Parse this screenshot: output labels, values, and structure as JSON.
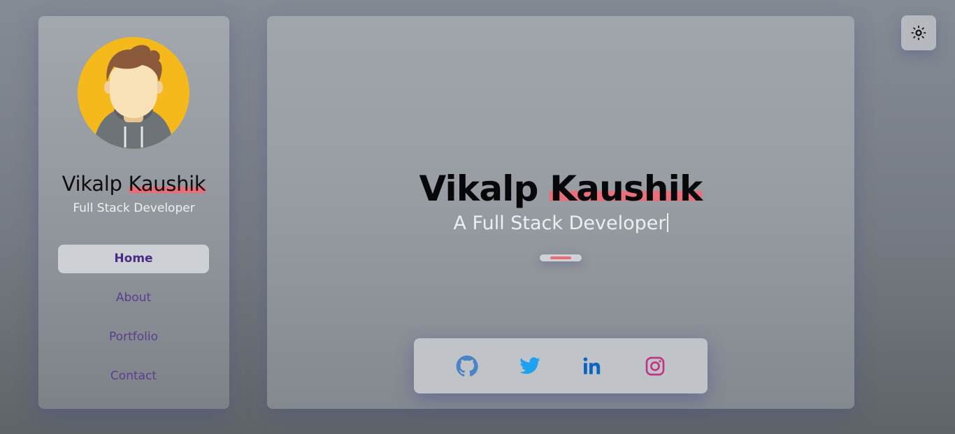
{
  "sidebar": {
    "name_first": "Vikalp",
    "name_last": "Kaushik",
    "role": "Full Stack Developer",
    "nav": [
      {
        "label": "Home",
        "active": true
      },
      {
        "label": "About",
        "active": false
      },
      {
        "label": "Portfolio",
        "active": false
      },
      {
        "label": "Contact",
        "active": false
      }
    ]
  },
  "hero": {
    "name_first": "Vikalp",
    "name_last": "Kaushik",
    "tagline": "A Full Stack Developer"
  },
  "social_links": [
    {
      "icon": "github-icon",
      "color": "#4a84c4"
    },
    {
      "icon": "twitter-icon",
      "color": "#1da1f2"
    },
    {
      "icon": "linkedin-icon",
      "color": "#0a66c2"
    },
    {
      "icon": "instagram-icon",
      "color": "#c13584"
    }
  ],
  "theme_toggle": {
    "icon": "sun-icon"
  },
  "colors": {
    "accent_highlight": "#e9707a",
    "nav_text": "#5b3c8f"
  }
}
